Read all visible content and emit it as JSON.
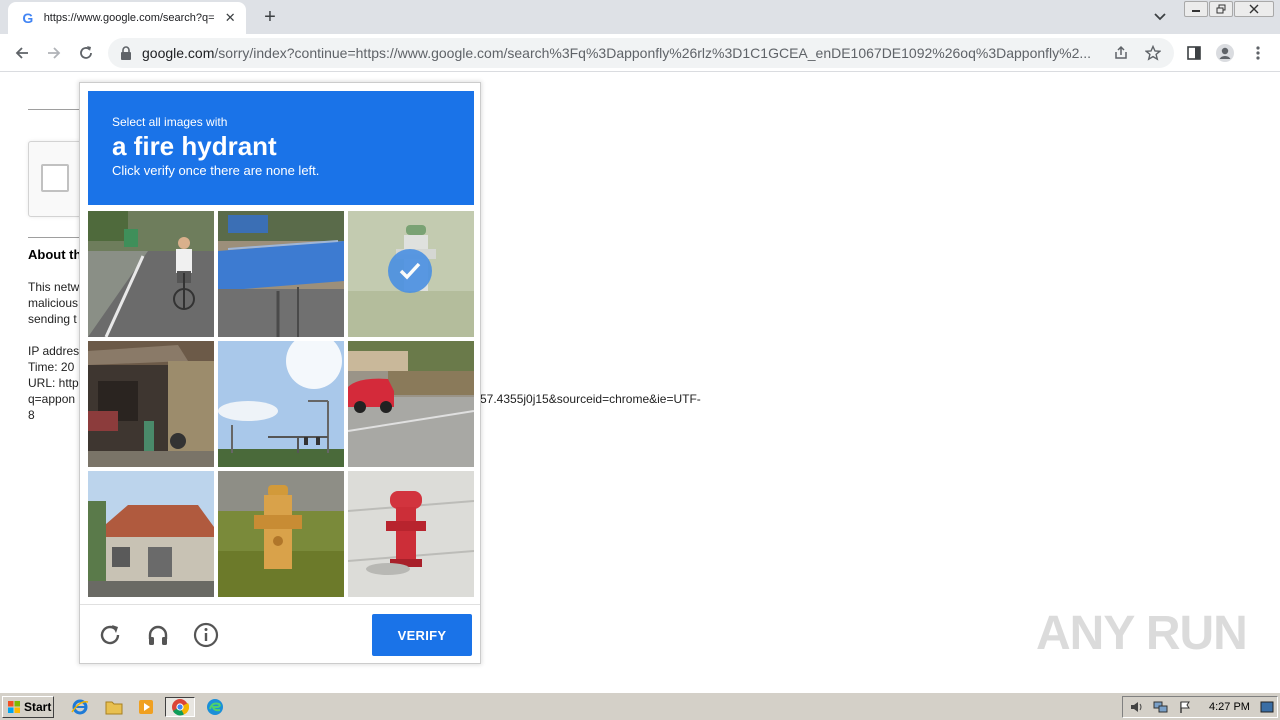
{
  "browser": {
    "tab_title": "https://www.google.com/search?q=",
    "tab_favicon": "G",
    "url_host": "google.com",
    "url_path": "/sorry/index?continue=https://www.google.com/search%3Fq%3Dapponfly%26rlz%3D1C1GCEA_enDE1067DE1092%26oq%3Dapponfly%2..."
  },
  "page": {
    "about_title": "About th",
    "para1": [
      "This netw",
      "malicious",
      "sending t"
    ],
    "para2": [
      "IP addres",
      "Time: 20",
      "URL: http",
      "q=appon",
      "8"
    ],
    "url_tail": "57.4355j0j15&sourceid=chrome&ie=UTF-"
  },
  "captcha": {
    "header_small": "Select all images with",
    "header_big": "a fire hydrant",
    "header_sub": "Click verify once there are none left.",
    "verify_label": "VERIFY",
    "accent": "#1a73e8",
    "tiles": [
      {
        "subject": "street-cyclist",
        "selected": false
      },
      {
        "subject": "blue-roof-shed",
        "selected": false
      },
      {
        "subject": "hydrant-on-grass",
        "selected": true
      },
      {
        "subject": "shop-front",
        "selected": false
      },
      {
        "subject": "sky-streetlights",
        "selected": false
      },
      {
        "subject": "red-car-street",
        "selected": false
      },
      {
        "subject": "house-roof",
        "selected": false
      },
      {
        "subject": "yellow-hydrant",
        "selected": false
      },
      {
        "subject": "red-hydrant",
        "selected": false
      }
    ]
  },
  "watermark": "ANY RUN",
  "taskbar": {
    "start_label": "Start",
    "clock": "4:27 PM"
  }
}
